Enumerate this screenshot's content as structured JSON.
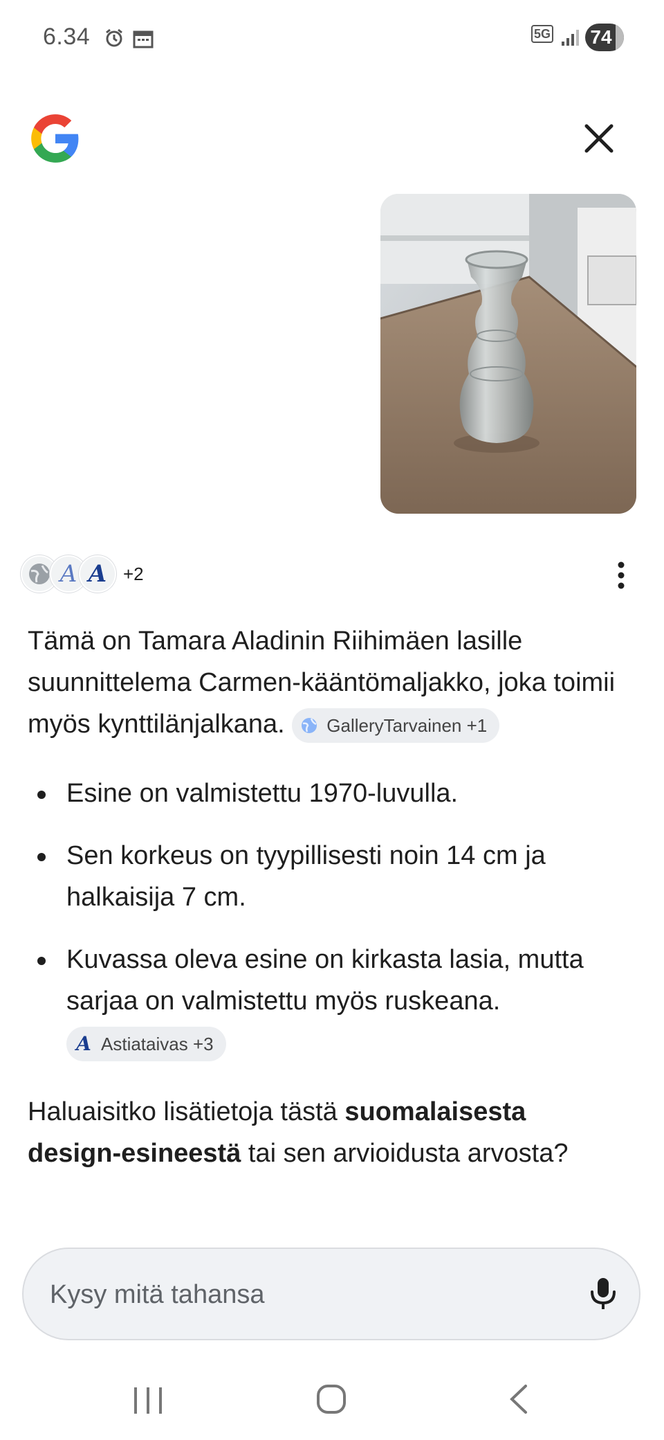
{
  "status_bar": {
    "time": "6.34",
    "network": "5G",
    "battery": "74"
  },
  "header": {
    "logo_icon": "google-g-logo",
    "close_icon": "close-icon"
  },
  "photo": {
    "description_icon": "uploaded-photo"
  },
  "sources": {
    "more_count": "+2"
  },
  "answer": {
    "text": "Tämä on Tamara Aladinin Riihimäen lasille suunnittelema Carmen-kääntömaljakko, joka toimii myös kynttilänjalkana.",
    "chip": "GalleryTarvainen +1"
  },
  "bullets": [
    {
      "text": "Esine on valmistettu 1970-luvulla."
    },
    {
      "text": "Sen korkeus on tyypillisesti noin 14 cm ja halkaisija 7 cm."
    },
    {
      "text": "Kuvassa oleva esine on kirkasta lasia, mutta sarjaa on valmistettu myös ruskeana.",
      "chip": "Astiataivas +3"
    }
  ],
  "question": {
    "part1": "Haluaisitko lisätietoja tästä ",
    "bold": "suomalaisesta design-esineestä",
    "part2": " tai sen arvioidusta arvosta?"
  },
  "ask": {
    "placeholder": "Kysy mitä tahansa"
  },
  "colors": {
    "accent": "#1a73e8",
    "chip_bg": "#eceef1",
    "input_bg": "#f0f2f5"
  }
}
